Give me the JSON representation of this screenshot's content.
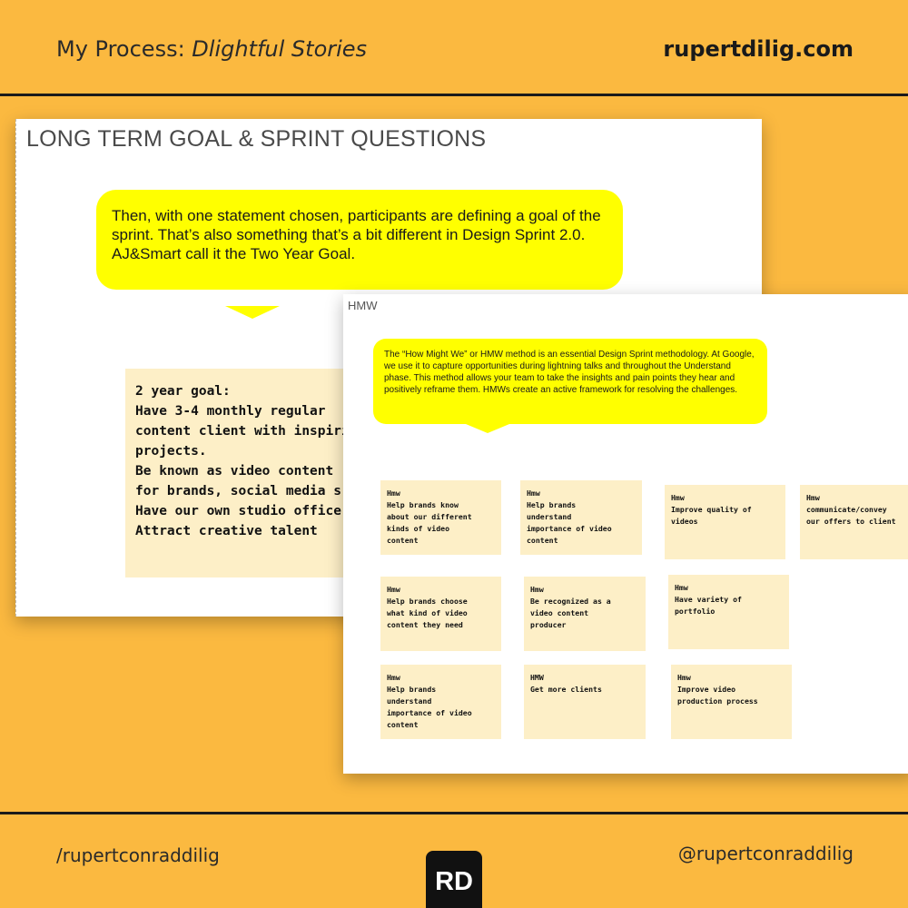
{
  "header": {
    "title_prefix": "My Process: ",
    "title_italic": "Dlightful Stories",
    "site": "rupertdilig.com"
  },
  "slide1": {
    "title": "LONG TERM GOAL & SPRINT QUESTIONS",
    "bubble_text": "Then, with one statement chosen, participants are defining a goal of the sprint. That’s also something that’s a bit different in Design Sprint 2.0. AJ&Smart call it the Two Year Goal.",
    "goal_note": "2 year goal:\nHave 3-4 monthly regular\ncontent client with inspiring\nprojects.\nBe known as video content\nfor brands, social media s\nHave our own studio office\nAttract creative talent"
  },
  "slide2": {
    "label": "HMW",
    "bubble_text": "The “How Might We” or HMW method is an essential Design Sprint methodology. At Google, we use it to capture opportunities during lightning talks and throughout the Understand phase. This method allows your team to take the insights and pain points they hear and positively reframe them. HMWs create an active framework for resolving the challenges.",
    "stickies": [
      "Hmw\nHelp brands know\nabout our different\nkinds of video\ncontent",
      "Hmw\nHelp brands\nunderstand\nimportance of video\ncontent",
      "Hmw\nImprove quality of\nvideos",
      "Hmw\ncommunicate/convey\nour offers to client",
      "Hmw\nHelp brands choose\nwhat kind of video\ncontent they need",
      "Hmw\nBe recognized as a\nvideo content\nproducer",
      "Hmw\nHave variety of\nportfolio",
      "Hmw\nHelp brands\nunderstand\nimportance of video\ncontent",
      "HMW\nGet more clients",
      "Hmw\nImprove video\nproduction process"
    ]
  },
  "footer": {
    "left_handle": "/rupertconraddilig",
    "right_handle": "@rupertconraddilig",
    "logo_text": "RD"
  },
  "colors": {
    "background": "#fbb940",
    "bubble": "#ffff00",
    "sticky": "#fdefc7",
    "rule": "#1a1a1a"
  }
}
